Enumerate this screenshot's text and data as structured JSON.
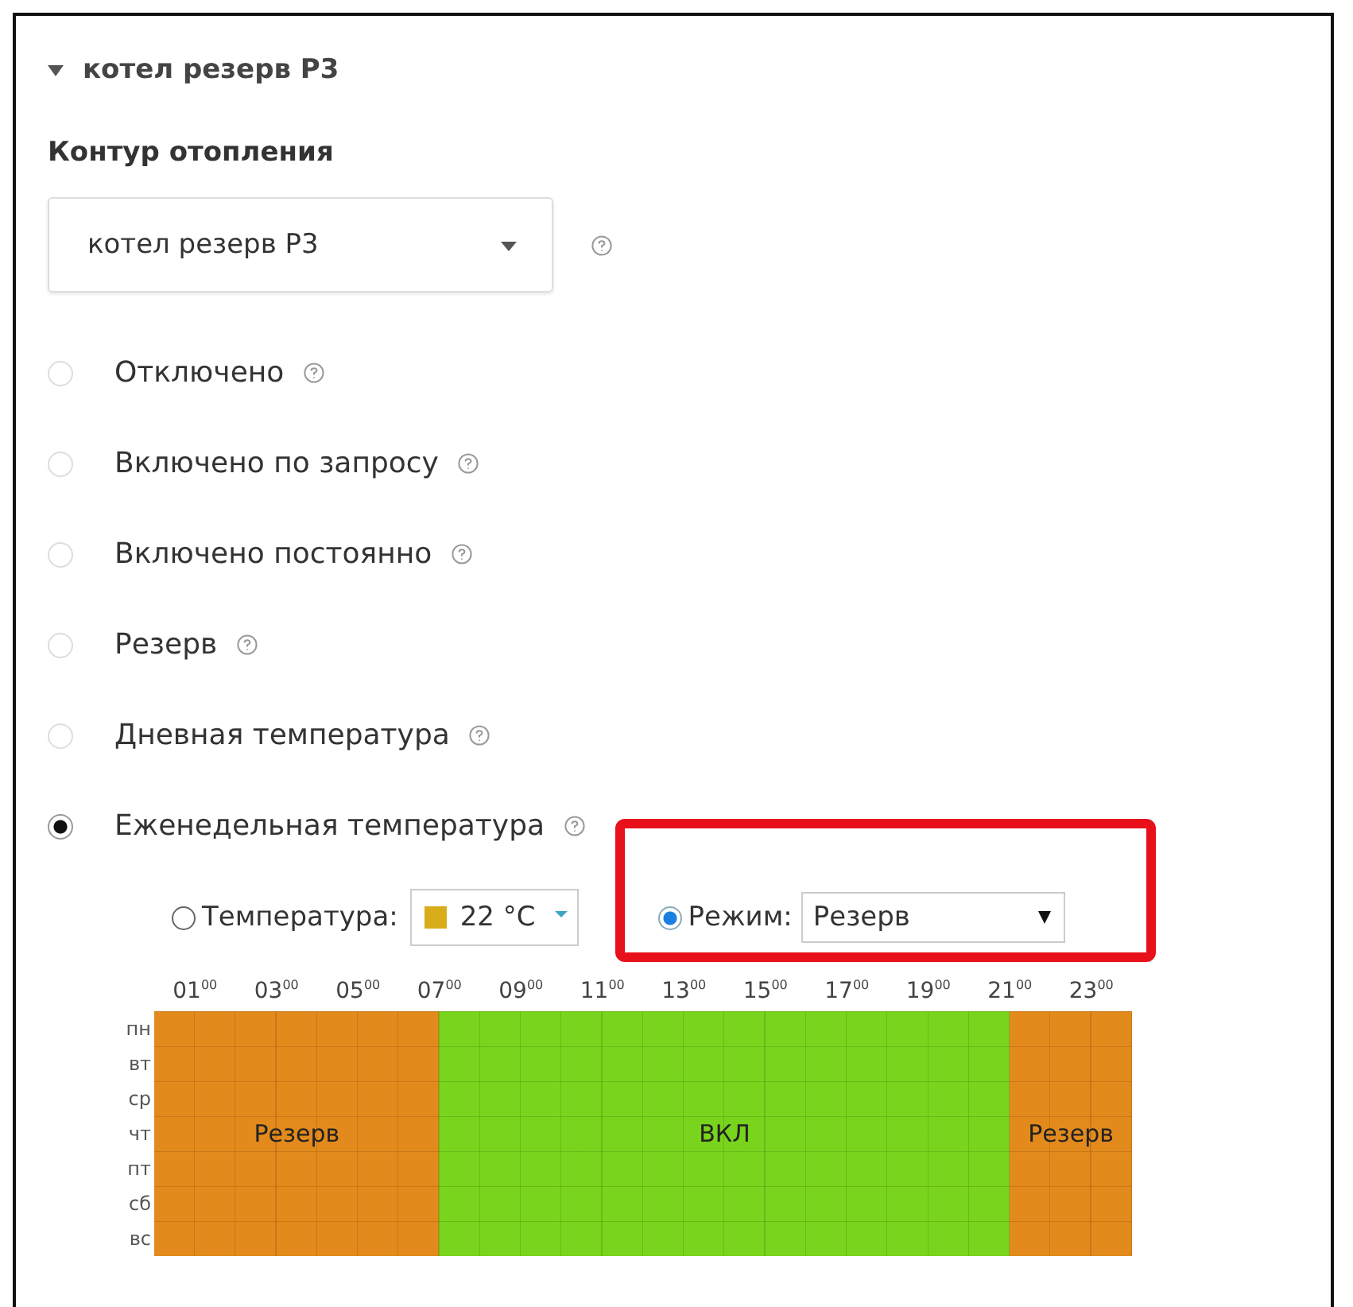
{
  "section": {
    "title": "котел резерв Р3",
    "expanded": true
  },
  "circuit": {
    "label": "Контур отопления",
    "value": "котел резерв Р3"
  },
  "modes": [
    {
      "label": "Отключено",
      "selected": false
    },
    {
      "label": "Включено по запросу",
      "selected": false
    },
    {
      "label": "Включено постоянно",
      "selected": false
    },
    {
      "label": "Резерв",
      "selected": false
    },
    {
      "label": "Дневная температура",
      "selected": false
    },
    {
      "label": "Еженедельная температура",
      "selected": true
    }
  ],
  "brush": [
    {
      "kind": "temperature",
      "label": "Температура:",
      "value": "22 °C",
      "color": "#d8ac1a",
      "selected": false
    },
    {
      "kind": "mode",
      "label": "Режим:",
      "value": "Резерв",
      "selected": true
    }
  ],
  "hours": [
    "01$^{00}$",
    "03$^{00}$",
    "05$^{00}$",
    "07$^{00}$",
    "09$^{00}$",
    "11$^{00}$",
    "13$^{00}$",
    "15$^{00}$",
    "17$^{00}$",
    "19$^{00}$",
    "21$^{00}$",
    "23$^{00}$"
  ],
  "days": [
    "пн",
    "вт",
    "ср",
    "чт",
    "пт",
    "сб",
    "вс"
  ],
  "hour_modes": [
    {
      "kind": "reserve"
    },
    {
      "kind": "reserve"
    },
    {
      "kind": "reserve"
    },
    {
      "kind": "reserve"
    },
    {
      "kind": "reserve"
    },
    {
      "kind": "reserve"
    },
    {
      "kind": "reserve"
    },
    {
      "kind": "on"
    },
    {
      "kind": "on"
    },
    {
      "kind": "on"
    },
    {
      "kind": "on"
    },
    {
      "kind": "on"
    },
    {
      "kind": "on"
    },
    {
      "kind": "on"
    },
    {
      "kind": "on"
    },
    {
      "kind": "on"
    },
    {
      "kind": "on"
    },
    {
      "kind": "on"
    },
    {
      "kind": "on"
    },
    {
      "kind": "on"
    },
    {
      "kind": "on"
    },
    {
      "kind": "reserve"
    },
    {
      "kind": "reserve"
    },
    {
      "kind": "reserve"
    }
  ],
  "block_labels": [
    "Резерв",
    "ВКЛ",
    "Резерв"
  ]
}
